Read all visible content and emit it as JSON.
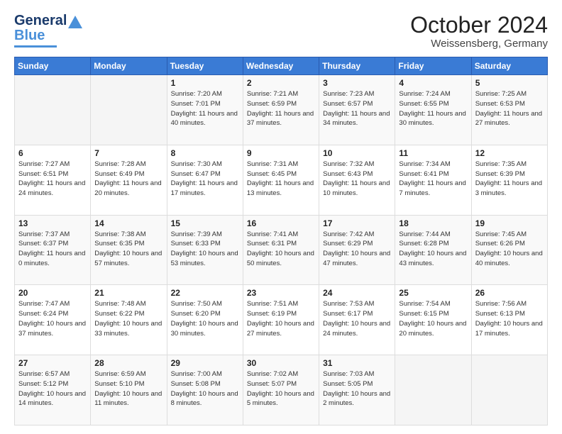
{
  "header": {
    "logo_general": "General",
    "logo_blue": "Blue",
    "month_title": "October 2024",
    "location": "Weissensberg, Germany"
  },
  "weekdays": [
    "Sunday",
    "Monday",
    "Tuesday",
    "Wednesday",
    "Thursday",
    "Friday",
    "Saturday"
  ],
  "weeks": [
    [
      {
        "day": "",
        "info": ""
      },
      {
        "day": "",
        "info": ""
      },
      {
        "day": "1",
        "info": "Sunrise: 7:20 AM\nSunset: 7:01 PM\nDaylight: 11 hours and 40 minutes."
      },
      {
        "day": "2",
        "info": "Sunrise: 7:21 AM\nSunset: 6:59 PM\nDaylight: 11 hours and 37 minutes."
      },
      {
        "day": "3",
        "info": "Sunrise: 7:23 AM\nSunset: 6:57 PM\nDaylight: 11 hours and 34 minutes."
      },
      {
        "day": "4",
        "info": "Sunrise: 7:24 AM\nSunset: 6:55 PM\nDaylight: 11 hours and 30 minutes."
      },
      {
        "day": "5",
        "info": "Sunrise: 7:25 AM\nSunset: 6:53 PM\nDaylight: 11 hours and 27 minutes."
      }
    ],
    [
      {
        "day": "6",
        "info": "Sunrise: 7:27 AM\nSunset: 6:51 PM\nDaylight: 11 hours and 24 minutes."
      },
      {
        "day": "7",
        "info": "Sunrise: 7:28 AM\nSunset: 6:49 PM\nDaylight: 11 hours and 20 minutes."
      },
      {
        "day": "8",
        "info": "Sunrise: 7:30 AM\nSunset: 6:47 PM\nDaylight: 11 hours and 17 minutes."
      },
      {
        "day": "9",
        "info": "Sunrise: 7:31 AM\nSunset: 6:45 PM\nDaylight: 11 hours and 13 minutes."
      },
      {
        "day": "10",
        "info": "Sunrise: 7:32 AM\nSunset: 6:43 PM\nDaylight: 11 hours and 10 minutes."
      },
      {
        "day": "11",
        "info": "Sunrise: 7:34 AM\nSunset: 6:41 PM\nDaylight: 11 hours and 7 minutes."
      },
      {
        "day": "12",
        "info": "Sunrise: 7:35 AM\nSunset: 6:39 PM\nDaylight: 11 hours and 3 minutes."
      }
    ],
    [
      {
        "day": "13",
        "info": "Sunrise: 7:37 AM\nSunset: 6:37 PM\nDaylight: 11 hours and 0 minutes."
      },
      {
        "day": "14",
        "info": "Sunrise: 7:38 AM\nSunset: 6:35 PM\nDaylight: 10 hours and 57 minutes."
      },
      {
        "day": "15",
        "info": "Sunrise: 7:39 AM\nSunset: 6:33 PM\nDaylight: 10 hours and 53 minutes."
      },
      {
        "day": "16",
        "info": "Sunrise: 7:41 AM\nSunset: 6:31 PM\nDaylight: 10 hours and 50 minutes."
      },
      {
        "day": "17",
        "info": "Sunrise: 7:42 AM\nSunset: 6:29 PM\nDaylight: 10 hours and 47 minutes."
      },
      {
        "day": "18",
        "info": "Sunrise: 7:44 AM\nSunset: 6:28 PM\nDaylight: 10 hours and 43 minutes."
      },
      {
        "day": "19",
        "info": "Sunrise: 7:45 AM\nSunset: 6:26 PM\nDaylight: 10 hours and 40 minutes."
      }
    ],
    [
      {
        "day": "20",
        "info": "Sunrise: 7:47 AM\nSunset: 6:24 PM\nDaylight: 10 hours and 37 minutes."
      },
      {
        "day": "21",
        "info": "Sunrise: 7:48 AM\nSunset: 6:22 PM\nDaylight: 10 hours and 33 minutes."
      },
      {
        "day": "22",
        "info": "Sunrise: 7:50 AM\nSunset: 6:20 PM\nDaylight: 10 hours and 30 minutes."
      },
      {
        "day": "23",
        "info": "Sunrise: 7:51 AM\nSunset: 6:19 PM\nDaylight: 10 hours and 27 minutes."
      },
      {
        "day": "24",
        "info": "Sunrise: 7:53 AM\nSunset: 6:17 PM\nDaylight: 10 hours and 24 minutes."
      },
      {
        "day": "25",
        "info": "Sunrise: 7:54 AM\nSunset: 6:15 PM\nDaylight: 10 hours and 20 minutes."
      },
      {
        "day": "26",
        "info": "Sunrise: 7:56 AM\nSunset: 6:13 PM\nDaylight: 10 hours and 17 minutes."
      }
    ],
    [
      {
        "day": "27",
        "info": "Sunrise: 6:57 AM\nSunset: 5:12 PM\nDaylight: 10 hours and 14 minutes."
      },
      {
        "day": "28",
        "info": "Sunrise: 6:59 AM\nSunset: 5:10 PM\nDaylight: 10 hours and 11 minutes."
      },
      {
        "day": "29",
        "info": "Sunrise: 7:00 AM\nSunset: 5:08 PM\nDaylight: 10 hours and 8 minutes."
      },
      {
        "day": "30",
        "info": "Sunrise: 7:02 AM\nSunset: 5:07 PM\nDaylight: 10 hours and 5 minutes."
      },
      {
        "day": "31",
        "info": "Sunrise: 7:03 AM\nSunset: 5:05 PM\nDaylight: 10 hours and 2 minutes."
      },
      {
        "day": "",
        "info": ""
      },
      {
        "day": "",
        "info": ""
      }
    ]
  ]
}
